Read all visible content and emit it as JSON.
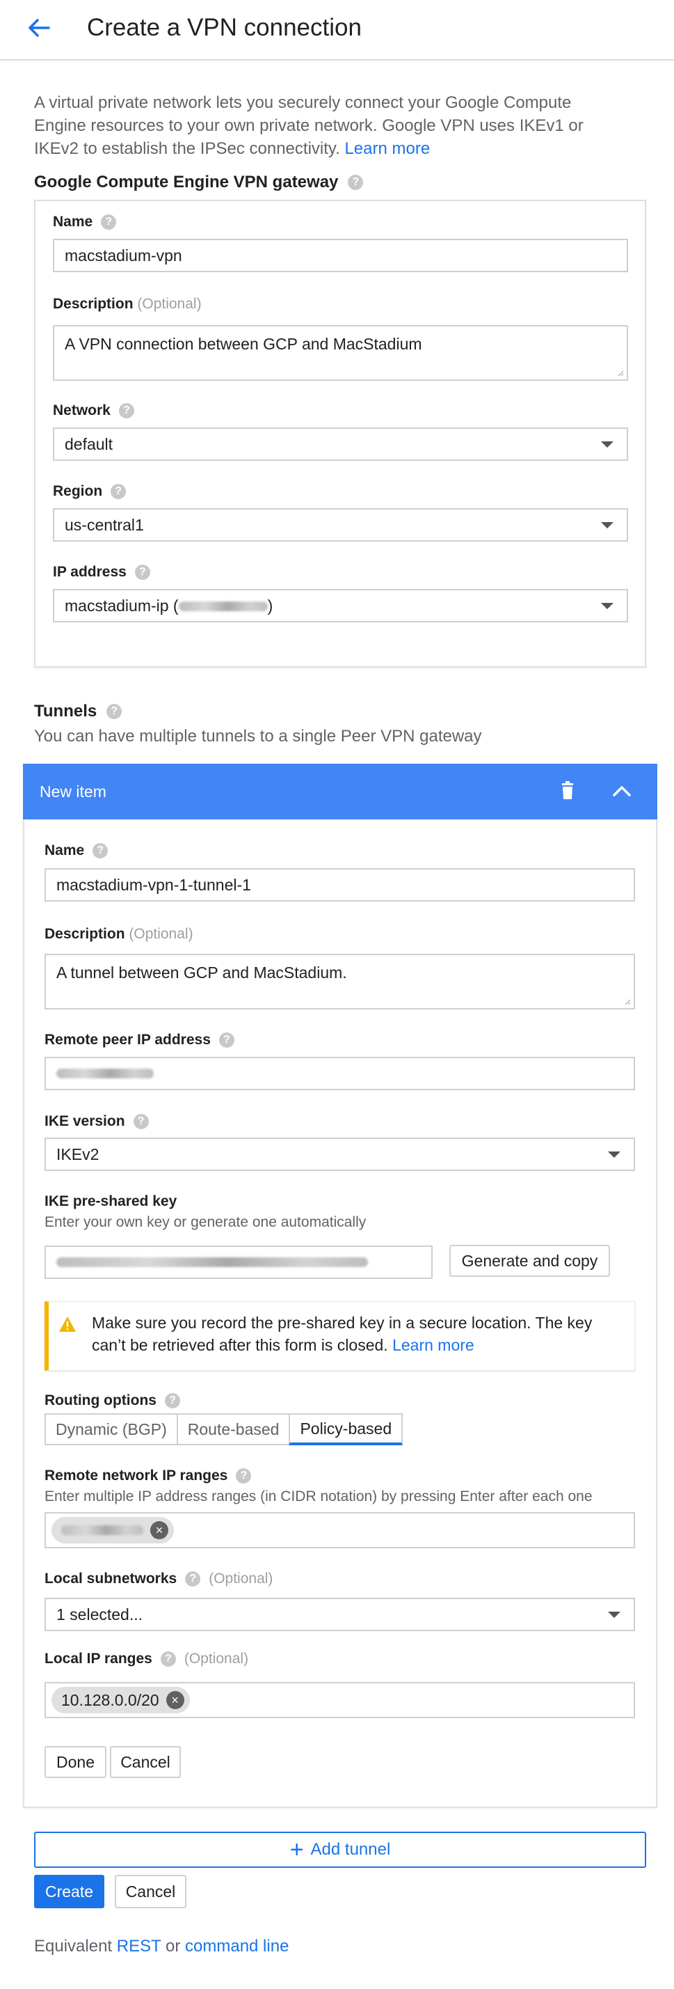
{
  "header": {
    "title": "Create a VPN connection"
  },
  "intro": {
    "text": "A virtual private network lets you securely connect your Google Compute Engine resources to your own private network. Google VPN uses IKEv1 or IKEv2 to establish the IPSec connectivity.",
    "link": "Learn more"
  },
  "gateway": {
    "heading": "Google Compute Engine VPN gateway",
    "name_label": "Name",
    "name_value": "macstadium-vpn",
    "description_label": "Description",
    "optional": "(Optional)",
    "description_value": "A VPN connection between GCP and MacStadium",
    "network_label": "Network",
    "network_value": "default",
    "region_label": "Region",
    "region_value": "us-central1",
    "ip_label": "IP address",
    "ip_value_prefix": "macstadium-ip (",
    "ip_value_suffix": ")"
  },
  "tunnels": {
    "heading": "Tunnels",
    "subtitle": "You can have multiple tunnels to a single Peer VPN gateway"
  },
  "item": {
    "title": "New item",
    "name_label": "Name",
    "name_value": "macstadium-vpn-1-tunnel-1",
    "description_label": "Description",
    "optional": "(Optional)",
    "description_value": "A tunnel between GCP and MacStadium.",
    "remote_peer_label": "Remote peer IP address",
    "ike_version_label": "IKE version",
    "ike_version_value": "IKEv2",
    "psk_label": "IKE pre-shared key",
    "psk_hint": "Enter your own key or generate one automatically",
    "generate_button": "Generate and copy",
    "warning_text": "Make sure you record the pre-shared key in a secure location. The key can’t be retrieved after this form is closed.",
    "warning_link": "Learn more",
    "routing_label": "Routing options",
    "routing_options": [
      "Dynamic (BGP)",
      "Route-based",
      "Policy-based"
    ],
    "routing_selected": "Policy-based",
    "remote_ranges_label": "Remote network IP ranges",
    "remote_ranges_hint": "Enter multiple IP address ranges (in CIDR notation) by pressing Enter after each one",
    "local_subnets_label": "Local subnetworks",
    "local_subnets_value": "1 selected...",
    "local_ip_label": "Local IP ranges",
    "local_ip_chip": "10.128.0.0/20",
    "done_button": "Done",
    "cancel_button": "Cancel"
  },
  "actions": {
    "add_tunnel": "Add tunnel",
    "create": "Create",
    "cancel": "Cancel"
  },
  "footer": {
    "prefix": "Equivalent",
    "rest": "REST",
    "or": "or",
    "command_line": "command line"
  },
  "colors": {
    "accent": "#1a73e8",
    "item_header": "#4285f4",
    "warning": "#f4b400"
  },
  "icons": {
    "back": "arrow-back-icon",
    "help": "help-icon",
    "trash": "trash-icon",
    "collapse": "chevron-up-icon",
    "dropdown": "caret-down-icon",
    "warning": "warning-icon",
    "chip_remove": "close-circle-icon",
    "add": "plus-icon"
  }
}
